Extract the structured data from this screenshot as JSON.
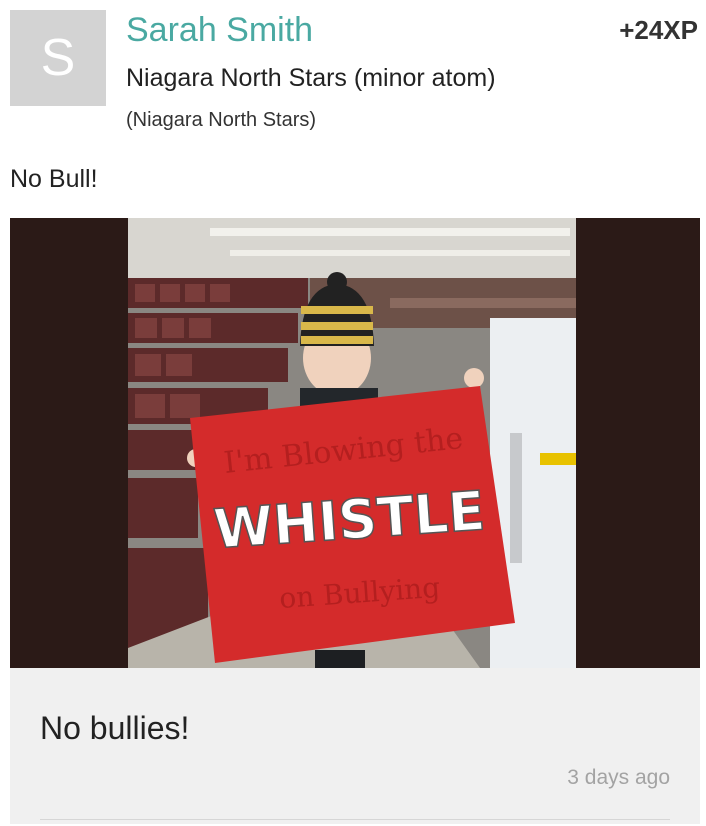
{
  "post": {
    "avatar_letter": "S",
    "user_name": "Sarah Smith",
    "xp": "+24XP",
    "team": "Niagara North Stars (minor atom)",
    "organization": "(Niagara North Stars)",
    "text": "No Bull!",
    "image": {
      "sign_line1": "I'm Blowing the",
      "sign_line2": "WHISTLE",
      "sign_line3": "on Bullying"
    },
    "comment": "No bullies!",
    "timestamp": "3 days ago"
  }
}
